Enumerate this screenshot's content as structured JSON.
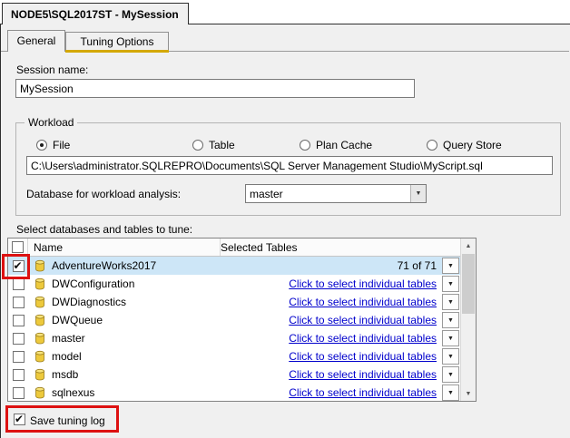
{
  "colors": {
    "annotation_red": "#dd1111",
    "selected_row_blue": "#cde6f7",
    "link_blue": "#0000cc",
    "tab_accent_yellow": "#d4a800",
    "panel_background": "#f0f0f0"
  },
  "window": {
    "doc_tab_title": "NODE5\\SQL2017ST - MySession"
  },
  "tabs": {
    "general": "General",
    "tuning_options": "Tuning Options"
  },
  "session": {
    "label": "Session name:",
    "value": "MySession"
  },
  "workload": {
    "group_label": "Workload",
    "options": [
      {
        "label": "File",
        "selected": true
      },
      {
        "label": "Table",
        "selected": false
      },
      {
        "label": "Plan Cache",
        "selected": false
      },
      {
        "label": "Query Store",
        "selected": false
      }
    ],
    "file_path": "C:\\Users\\administrator.SQLREPRO\\Documents\\SQL Server Management Studio\\MyScript.sql",
    "database_label": "Database for workload analysis:",
    "database_value": "master"
  },
  "grid": {
    "caption": "Select databases and tables to tune:",
    "columns": {
      "name": "Name",
      "selected_tables": "Selected Tables"
    },
    "rows": [
      {
        "name": "AdventureWorks2017",
        "checked": true,
        "tables": "71 of 71"
      },
      {
        "name": "DWConfiguration",
        "checked": false,
        "tables": "Click to select individual tables"
      },
      {
        "name": "DWDiagnostics",
        "checked": false,
        "tables": "Click to select individual tables"
      },
      {
        "name": "DWQueue",
        "checked": false,
        "tables": "Click to select individual tables"
      },
      {
        "name": "master",
        "checked": false,
        "tables": "Click to select individual tables"
      },
      {
        "name": "model",
        "checked": false,
        "tables": "Click to select individual tables"
      },
      {
        "name": "msdb",
        "checked": false,
        "tables": "Click to select individual tables"
      },
      {
        "name": "sqlnexus",
        "checked": false,
        "tables": "Click to select individual tables"
      }
    ]
  },
  "footer": {
    "save_tuning_log_label": "Save tuning log"
  }
}
